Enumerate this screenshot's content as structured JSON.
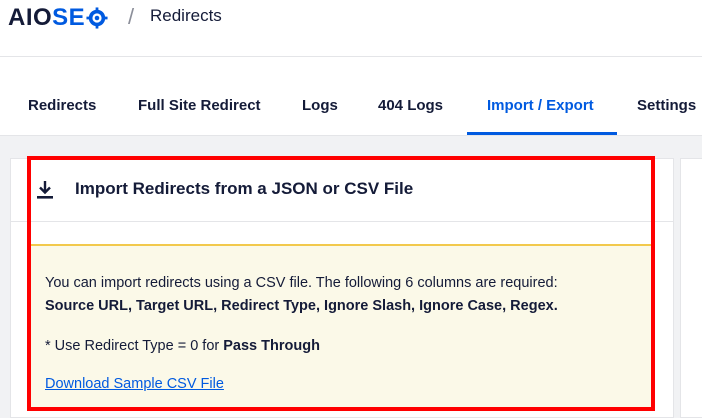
{
  "app": {
    "logo_prefix": "AIO",
    "logo_suffix": "SE",
    "logo_end": "O",
    "separator": "/",
    "page_title": "Redirects"
  },
  "tabs": [
    {
      "label": "Redirects",
      "active": false
    },
    {
      "label": "Full Site Redirect",
      "active": false
    },
    {
      "label": "Logs",
      "active": false
    },
    {
      "label": "404 Logs",
      "active": false
    },
    {
      "label": "Import / Export",
      "active": true
    },
    {
      "label": "Settings",
      "active": false
    }
  ],
  "import_panel": {
    "icon": "download-icon",
    "title": "Import Redirects from a JSON or CSV File",
    "notice_line1": "You can import redirects using a CSV file. The following 6 columns are required:",
    "notice_line2": "Source URL, Target URL, Redirect Type, Ignore Slash, Ignore Case, Regex.",
    "notice_line3_prefix": "* Use Redirect Type = 0 for ",
    "notice_line3_bold": "Pass Through",
    "download_link": "Download Sample CSV File"
  },
  "colors": {
    "accent": "#005ae0",
    "highlight": "#ff0000",
    "notice_bg": "#fbf9e8",
    "notice_border": "#f2c94c",
    "text": "#141b38"
  }
}
